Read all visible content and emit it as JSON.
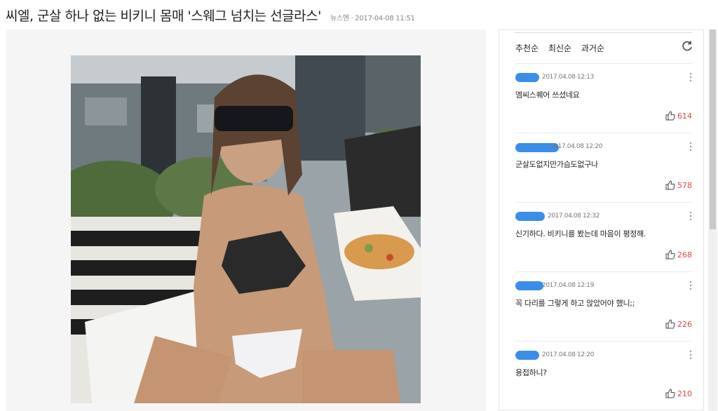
{
  "article": {
    "title": "씨엘, 군살 하나 없는 비키니 몸매 '스웨그 넘치는 선글라스'",
    "source": "뉴스엔",
    "datetime": "2017-04-08 11:51"
  },
  "comments": {
    "sort_tabs": [
      "추천순",
      "최신순",
      "과거순"
    ],
    "items": [
      {
        "date": "2017.04.08 12:13",
        "text": "엠씨스퀘어 쓰셨네요",
        "likes": "614"
      },
      {
        "date": "2017.04.08 12:20",
        "text": "군살도없지만가슴도없구나",
        "likes": "578"
      },
      {
        "date": "2017.04.08 12:32",
        "text": "신기하다. 비키니를 봤는데 마음이 평정해.",
        "likes": "268"
      },
      {
        "date": "2017.04.08 12:19",
        "text": "꼭 다리를 그렇게 하고 앉았어야 했니;;",
        "likes": "226"
      },
      {
        "date": "2017.04.08 12:20",
        "text": "용접하니?",
        "likes": "210"
      }
    ]
  },
  "colors": {
    "like": "#e0434b",
    "redaction": "#3a8ee8"
  }
}
